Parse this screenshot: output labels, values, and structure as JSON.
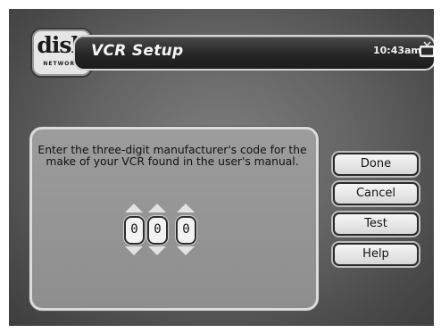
{
  "header": {
    "logo_word": "dish",
    "logo_sub": "NETWORK",
    "title": "VCR Setup",
    "time": "10:43am"
  },
  "panel": {
    "instruction": "Enter the three-digit manufacturer's code for the make of your VCR found in the user's manual.",
    "digits": [
      "0",
      "0",
      "0"
    ]
  },
  "buttons": {
    "done": "Done",
    "cancel": "Cancel",
    "test": "Test",
    "help": "Help"
  },
  "icons": {
    "tv": "tv-icon",
    "up": "arrow-up-icon",
    "down": "arrow-down-icon"
  }
}
